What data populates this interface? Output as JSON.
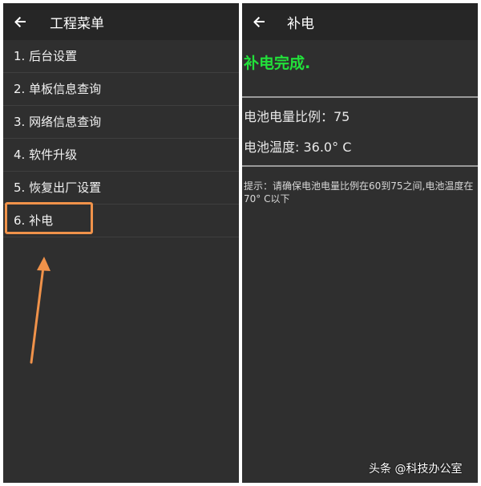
{
  "left": {
    "title": "工程菜单",
    "items": [
      {
        "label": "1. 后台设置"
      },
      {
        "label": "2. 单板信息查询"
      },
      {
        "label": "3. 网络信息查询"
      },
      {
        "label": "4. 软件升级"
      },
      {
        "label": "5. 恢复出厂设置"
      },
      {
        "label": "6. 补电"
      }
    ]
  },
  "right": {
    "title": "补电",
    "status": "补电完成.",
    "battery_ratio": "电池电量比例：75",
    "battery_temp": "电池温度: 36.0° C",
    "hint": "提示：请确保电池电量比例在60到75之间,电池温度在70° C以下"
  },
  "watermark": "头条 @科技办公室",
  "colors": {
    "highlight": "#f0924a",
    "success": "#22e03a",
    "background": "#2f2f2f"
  }
}
